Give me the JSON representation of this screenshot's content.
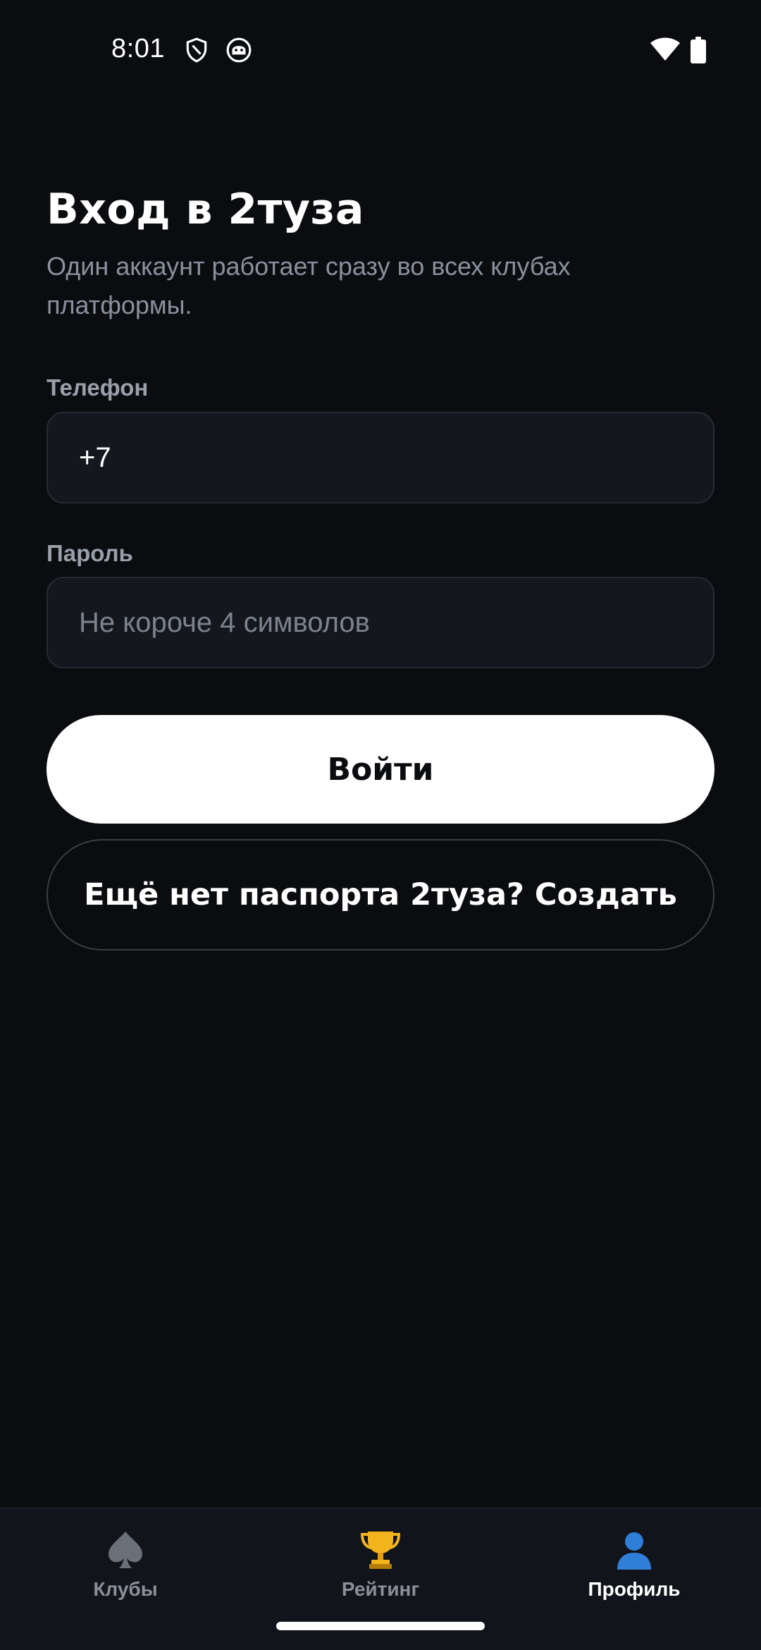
{
  "status_bar": {
    "time": "8:01",
    "icons": [
      "shield-icon",
      "notification-icon",
      "wifi-icon",
      "battery-icon"
    ]
  },
  "header": {
    "title": "Вход в 2туза",
    "subtitle": "Один аккаунт работает сразу во всех клубах платформы."
  },
  "form": {
    "phone": {
      "label": "Телефон",
      "value": "+7"
    },
    "password": {
      "label": "Пароль",
      "placeholder": "Не короче 4 символов",
      "value": ""
    }
  },
  "buttons": {
    "login": "Войти",
    "register": "Ещё нет паспорта 2туза? Создать"
  },
  "bottom_nav": {
    "items": [
      {
        "label": "Клубы",
        "icon": "spade-icon",
        "active": false
      },
      {
        "label": "Рейтинг",
        "icon": "trophy-icon",
        "active": false
      },
      {
        "label": "Профиль",
        "icon": "user-icon",
        "active": true
      }
    ]
  },
  "colors": {
    "background": "#0b0c10",
    "input_background": "#14171d",
    "primary_button": "#ffffff",
    "accent_profile": "#2f7fd8",
    "trophy": "#f2b41d"
  }
}
